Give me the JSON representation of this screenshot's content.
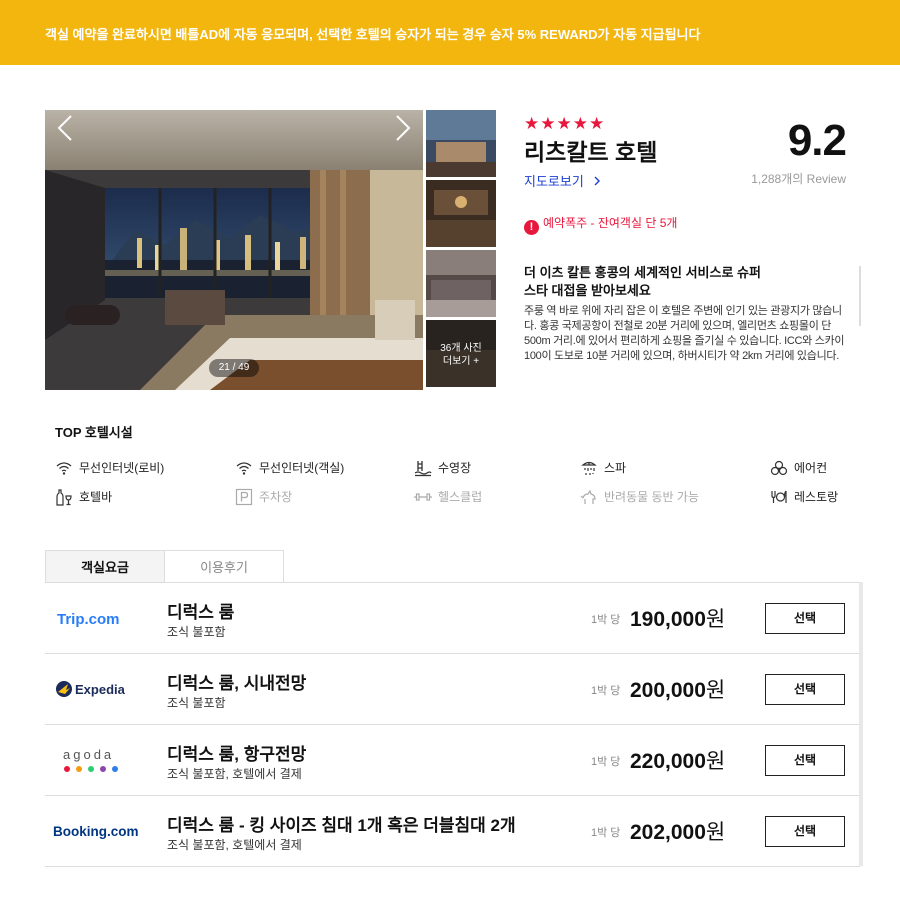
{
  "banner": {
    "text": "객실 예약을 완료하시면 배틀AD에 자동 응모되며, 선택한 호텔의 승자가 되는 경우 승자 5% REWARD가 자동 지급됩니다"
  },
  "gallery": {
    "counter": "21 / 49",
    "more_line1": "36개 사진",
    "more_line2": "더보기 +"
  },
  "hotel": {
    "stars": "★★★★★",
    "star_count": 5,
    "name": "리츠칼트 호텔",
    "map_link": "지도로보기",
    "score": "9.2",
    "review_count": "1,288개의 Review",
    "alert": "예약폭주 - 잔여객실 단 5개",
    "desc_title": "더 이츠 칼튼 홍콩의 세계적인 서비스로 슈퍼스타 대접을 받아보세요",
    "desc_text": "주룽 역 바로 위에 자리 잡은 이 호텔은 주변에 인기 있는 관광지가 많습니다. 홍콩 국제공항이 전철로 20분 거리에 있으며, 엘리먼츠 쇼핑몰이 단 500m 거리.에 있어서 편리하게 쇼핑을 즐기실 수 있습니다. ICC와 스카이 100이 도보로 10분 거리에 있으며, 하버시티가 약 2km 거리에 있습니다."
  },
  "facilities": {
    "title": "TOP 호텔시설",
    "items": [
      {
        "label": "무선인터넷(로비)",
        "icon": "wifi-icon",
        "available": true
      },
      {
        "label": "무선인터넷(객실)",
        "icon": "wifi-icon",
        "available": true
      },
      {
        "label": "수영장",
        "icon": "pool-icon",
        "available": true
      },
      {
        "label": "스파",
        "icon": "spa-icon",
        "available": true
      },
      {
        "label": "에어컨",
        "icon": "air-conditioner-icon",
        "available": true
      },
      {
        "label": "호텔바",
        "icon": "bar-icon",
        "available": true
      },
      {
        "label": "주차장",
        "icon": "parking-icon",
        "available": false
      },
      {
        "label": "헬스클럽",
        "icon": "dumbbell-icon",
        "available": false
      },
      {
        "label": "반려동물 동반 가능",
        "icon": "pet-icon",
        "available": false
      },
      {
        "label": "레스토랑",
        "icon": "restaurant-icon",
        "available": true
      }
    ]
  },
  "tabs": [
    {
      "label": "객실요금",
      "active": true
    },
    {
      "label": "이용후기",
      "active": false
    }
  ],
  "rooms": [
    {
      "provider": "Trip.com",
      "name": "디럭스 룸",
      "sub": "조식 불포함",
      "per_night": "1박 당",
      "price": "190,000",
      "currency": "원",
      "button": "선택"
    },
    {
      "provider": "Expedia",
      "name": "디럭스 룸, 시내전망",
      "sub": "조식 불포함",
      "per_night": "1박 당",
      "price": "200,000",
      "currency": "원",
      "button": "선택"
    },
    {
      "provider": "agoda",
      "name": "디럭스 룸, 항구전망",
      "sub": "조식 불포함, 호텔에서 결제",
      "per_night": "1박 당",
      "price": "220,000",
      "currency": "원",
      "button": "선택"
    },
    {
      "provider": "Booking.com",
      "name": "디럭스 룸 - 킹 사이즈 침대 1개 혹은 더블침대 2개",
      "sub": "조식 불포함, 호텔에서 결제",
      "per_night": "1박 당",
      "price": "202,000",
      "currency": "원",
      "button": "선택"
    }
  ],
  "colors": {
    "banner": "#f2b60f",
    "accent_red": "#e8173c",
    "link_blue": "#1b3fd1",
    "trip_blue": "#287dfa",
    "expedia_navy": "#1b2b5a",
    "expedia_yellow": "#fcc011",
    "booking_navy": "#003580",
    "booking_light": "#009fe3"
  }
}
